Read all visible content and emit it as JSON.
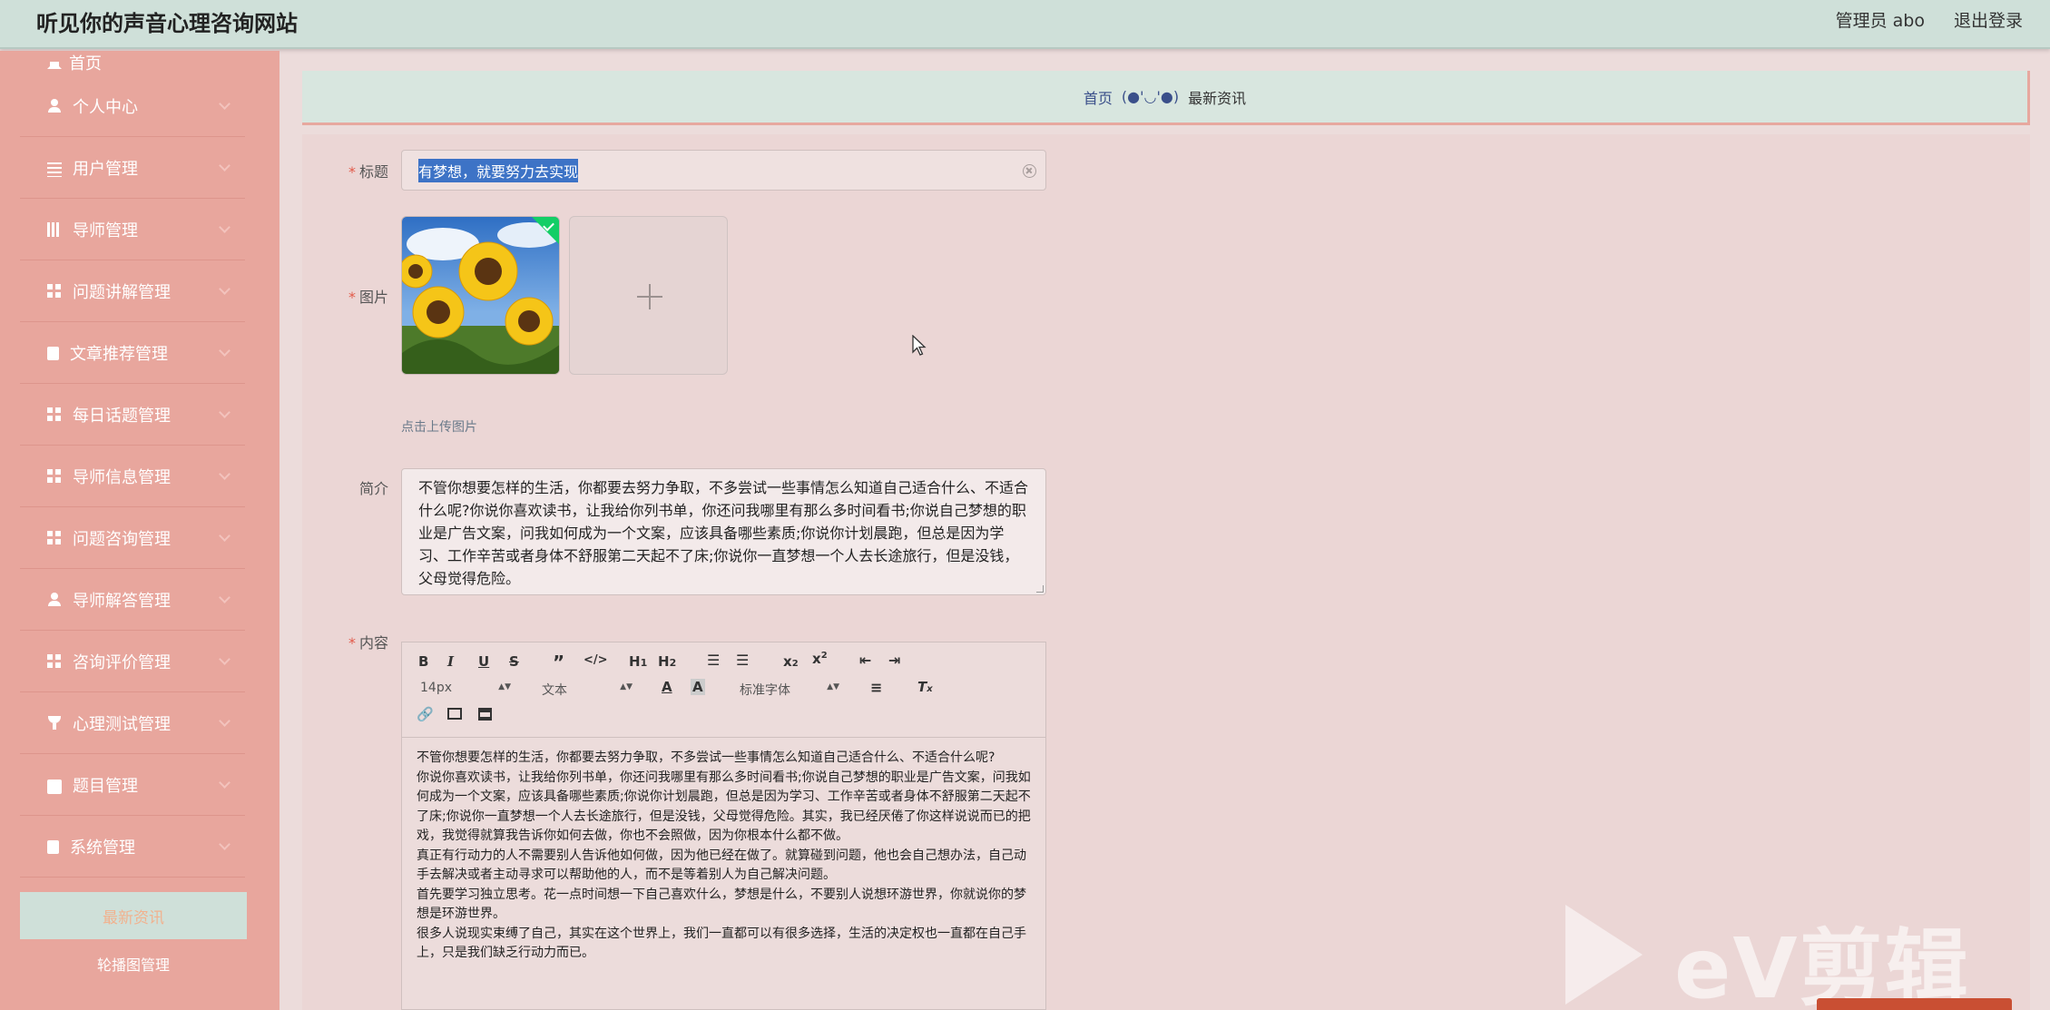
{
  "header": {
    "site_title": "听见你的声音心理咨询网站",
    "admin": "管理员 abo",
    "logout": "退出登录"
  },
  "sidebar": {
    "items": [
      {
        "label": "首页",
        "icon": "home-icon"
      },
      {
        "label": "个人中心",
        "icon": "user-icon"
      },
      {
        "label": "用户管理",
        "icon": "list-icon"
      },
      {
        "label": "导师管理",
        "icon": "bars-icon"
      },
      {
        "label": "问题讲解管理",
        "icon": "grid-icon"
      },
      {
        "label": "文章推荐管理",
        "icon": "clipboard-icon"
      },
      {
        "label": "每日话题管理",
        "icon": "grid-icon"
      },
      {
        "label": "导师信息管理",
        "icon": "grid-icon"
      },
      {
        "label": "问题咨询管理",
        "icon": "grid-icon"
      },
      {
        "label": "导师解答管理",
        "icon": "user-icon"
      },
      {
        "label": "咨询评价管理",
        "icon": "grid-icon"
      },
      {
        "label": "心理测试管理",
        "icon": "trophy-icon"
      },
      {
        "label": "题目管理",
        "icon": "briefcase-icon"
      },
      {
        "label": "系统管理",
        "icon": "clipboard-icon"
      }
    ],
    "active_sub": "最新资讯",
    "sub_item": "轮播图管理"
  },
  "breadcrumb": {
    "home": "首页",
    "separator": "(●'◡'●)",
    "current": "最新资讯"
  },
  "form": {
    "title_label": "标题",
    "title_value": "有梦想，就要努力去实现",
    "image_label": "图片",
    "upload_hint": "点击上传图片",
    "intro_label": "简介",
    "intro_value": "不管你想要怎样的生活，你都要去努力争取，不多尝试一些事情怎么知道自己适合什么、不适合什么呢?你说你喜欢读书，让我给你列书单，你还问我哪里有那么多时间看书;你说自己梦想的职业是广告文案，问我如何成为一个文案，应该具备哪些素质;你说你计划晨跑，但总是因为学习、工作辛苦或者身体不舒服第二天起不了床;你说你一直梦想一个人去长途旅行，但是没钱，父母觉得危险。",
    "content_label": "内容",
    "toolbar": {
      "font_size": "14px",
      "paragraph": "文本",
      "font_family": "标准字体"
    },
    "content_paragraphs": [
      "不管你想要怎样的生活，你都要去努力争取，不多尝试一些事情怎么知道自己适合什么、不适合什么呢?",
      "你说你喜欢读书，让我给你列书单，你还问我哪里有那么多时间看书;你说自己梦想的职业是广告文案，问我如何成为一个文案，应该具备哪些素质;你说你计划晨跑，但总是因为学习、工作辛苦或者身体不舒服第二天起不了床;你说你一直梦想一个人去长途旅行，但是没钱，父母觉得危险。其实，我已经厌倦了你这样说说而已的把戏，我觉得就算我告诉你如何去做，你也不会照做，因为你根本什么都不做。",
      "真正有行动力的人不需要别人告诉他如何做，因为他已经在做了。就算碰到问题，他也会自己想办法，自己动手去解决或者主动寻求可以帮助他的人，而不是等着别人为自己解决问题。",
      "首先要学习独立思考。花一点时间想一下自己喜欢什么，梦想是什么，不要别人说想环游世界，你就说你的梦想是环游世界。",
      "很多人说现实束缚了自己，其实在这个世界上，我们一直都可以有很多选择，生活的决定权也一直都在自己手上，只是我们缺乏行动力而已。"
    ]
  },
  "watermark": {
    "text": "eV剪辑"
  },
  "colors": {
    "header_bg": "#cfe0d9",
    "sidebar_bg": "#e8a69d",
    "panel_bg": "#ebd6d5",
    "active_menu_text": "#f1b28f"
  }
}
